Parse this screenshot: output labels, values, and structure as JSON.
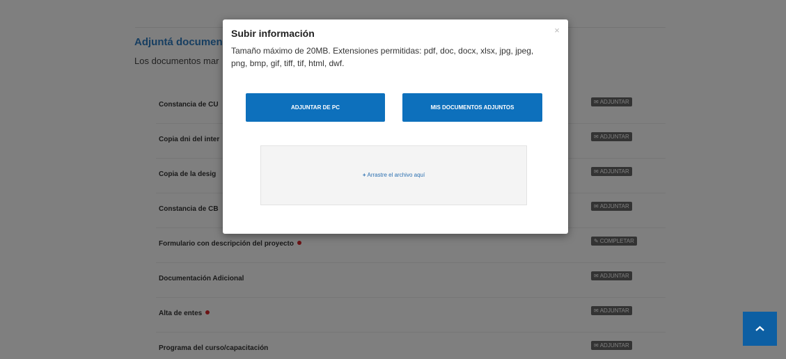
{
  "section": {
    "title": "Adjuntá documen",
    "subtitle": "Los documentos mar"
  },
  "documents": [
    {
      "name": "Constancia de CU",
      "required": false,
      "action": "ADJUNTAR",
      "action_icon": "paperclip-icon"
    },
    {
      "name": "Copia dni del inter",
      "required": false,
      "action": "ADJUNTAR",
      "action_icon": "paperclip-icon"
    },
    {
      "name": "Copia de la desig",
      "required": false,
      "action": "ADJUNTAR",
      "action_icon": "paperclip-icon"
    },
    {
      "name": "Constancia de CB",
      "required": false,
      "action": "ADJUNTAR",
      "action_icon": "paperclip-icon"
    },
    {
      "name": "Formulario con descripción del proyecto",
      "required": true,
      "action": "COMPLETAR",
      "action_icon": "pencil-icon"
    },
    {
      "name": "Documentación Adicional",
      "required": false,
      "action": "ADJUNTAR",
      "action_icon": "paperclip-icon"
    },
    {
      "name": "Alta de entes",
      "required": true,
      "action": "ADJUNTAR",
      "action_icon": "paperclip-icon"
    },
    {
      "name": "Programa del curso/capacitación",
      "required": false,
      "action": "ADJUNTAR",
      "action_icon": "paperclip-icon"
    }
  ],
  "modal": {
    "title": "Subir información",
    "description": "Tamaño máximo de 20MB. Extensiones permitidas: pdf, doc, docx, xlsx, jpg, jpeg, png, bmp, gif, tiff, tif, html, dwf.",
    "close_icon": "×",
    "btn_pc": "ADJUNTAR DE PC",
    "btn_docs": "MIS DOCUMENTOS ADJUNTOS",
    "dropzone_icon": "+",
    "dropzone_text": "Arrastre el archivo aquí"
  },
  "colors": {
    "primary": "#0d70bc",
    "scroll_top": "#0d5fa3",
    "section_title": "#2e7dc2",
    "required": "#d9262b",
    "action_badge": "#666666"
  }
}
